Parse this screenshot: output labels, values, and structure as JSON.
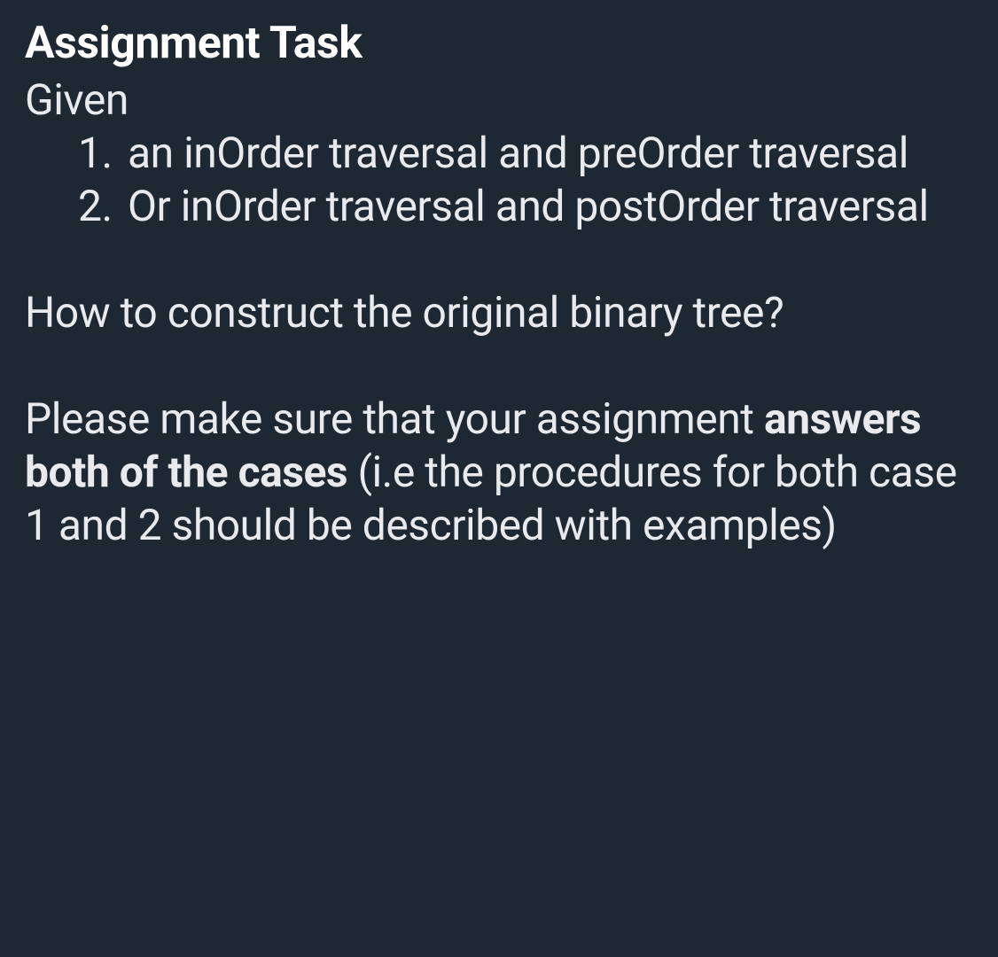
{
  "heading": "Assignment Task",
  "given_label": "Given",
  "list_items": [
    "an inOrder traversal and preOrder traversal",
    "Or inOrder traversal and postOrder traversal"
  ],
  "question": "How to construct the original binary tree?",
  "closing_part1": "Please make sure that your assignment ",
  "closing_bold": "answers both of the cases",
  "closing_part2": " (i.e the procedures for both case 1 and 2 should be described with examples)"
}
